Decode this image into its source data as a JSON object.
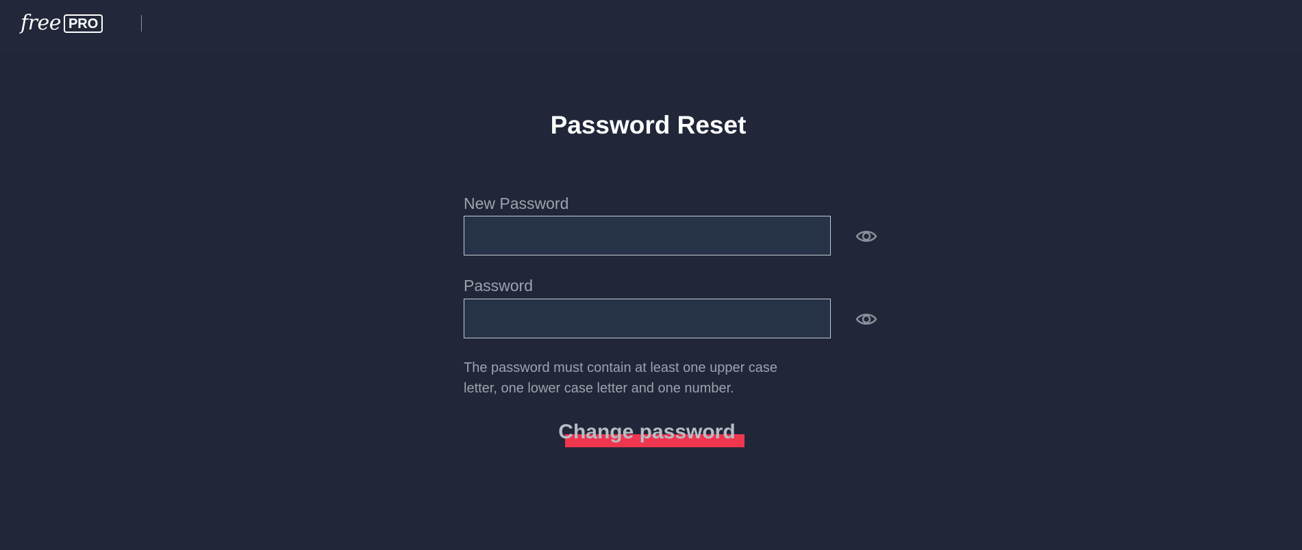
{
  "header": {
    "logo_text": "free",
    "logo_badge": "PRO"
  },
  "page": {
    "title": "Password Reset"
  },
  "form": {
    "new_password": {
      "label": "New Password",
      "value": "",
      "toggle_icon": "eye-icon"
    },
    "password": {
      "label": "Password",
      "value": "",
      "toggle_icon": "eye-icon"
    },
    "hint_line1": "The password must contain at least one upper case",
    "hint_line2": "letter, one lower case letter and one number.",
    "submit_label": "Change password"
  },
  "colors": {
    "background": "#212739",
    "input_background": "#263248",
    "accent": "#f0354f",
    "label_text": "#9da2ad"
  }
}
